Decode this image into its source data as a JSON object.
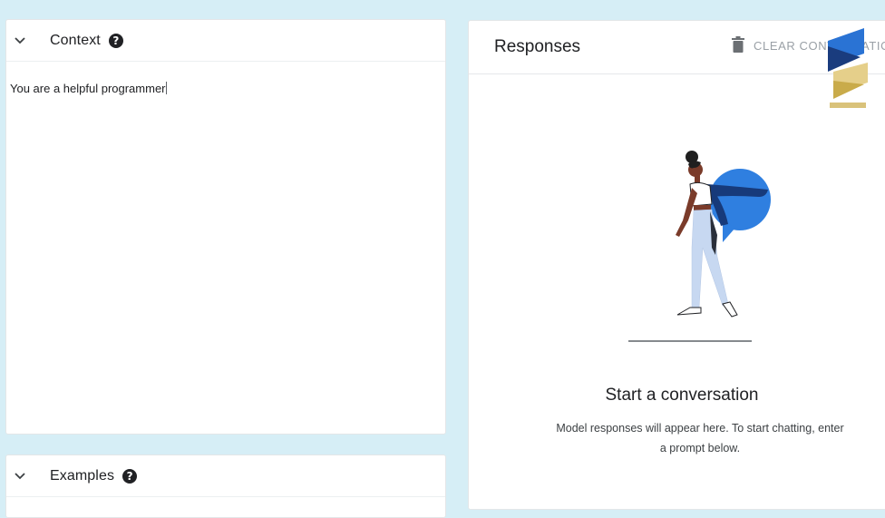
{
  "context_panel": {
    "title": "Context",
    "text": "You are a helpful programmer"
  },
  "examples_panel": {
    "title": "Examples"
  },
  "responses_panel": {
    "title": "Responses",
    "clear_label": "CLEAR CONVERSATION",
    "empty_title": "Start a conversation",
    "empty_description": "Model responses will appear here. To start chatting, enter a prompt below."
  },
  "colors": {
    "background": "#d6eef6",
    "bubble_blue": "#2f7fe0",
    "pants": "#c7d8f1",
    "skin": "#7a3b2a"
  },
  "icons": [
    "chevron-down-icon",
    "help-icon",
    "trash-icon",
    "watermark-logo"
  ]
}
